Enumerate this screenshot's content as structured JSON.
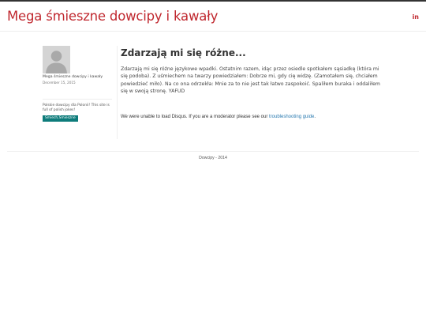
{
  "header": {
    "site_title": "Mega śmieszne dowcipy i kawały",
    "social_icon": "in"
  },
  "sidebar": {
    "author_name": "Mega śmieszne dowcipy i kawały",
    "date": "December 15, 2015",
    "description": "Polskie dowcipy dla Polonii! This site is full of polish jokes!",
    "tag": "Smiech,Smieszne"
  },
  "post": {
    "title": "Zdarzają mi się różne...",
    "body": "Zdarzają mi się różne językowe wpadki. Ostatnim razem, idąc przez osiedle spotkałem sąsiadkę (która mi się podoba). Z uśmiechem na twarzy powiedziałem: Dobrze mi, gdy cię widzę. (Zamotałem się, chciałem powiedzieć miło). Na co ona odrzekła: Mnie za to nie jest tak łatwo zaspokoić. Spaliłem buraka i oddaliłem się w swoją stronę. YAFUD"
  },
  "comments": {
    "message": "We were unable to load Disqus. If you are a moderator please see our",
    "link_text": "troubleshooting guide",
    "suffix": "."
  },
  "footer": {
    "text": "Dowcipy - 2014"
  },
  "colors": {
    "brand": "#c0282f",
    "tag_bg": "#0e7c7b",
    "link": "#2a7ab0"
  }
}
